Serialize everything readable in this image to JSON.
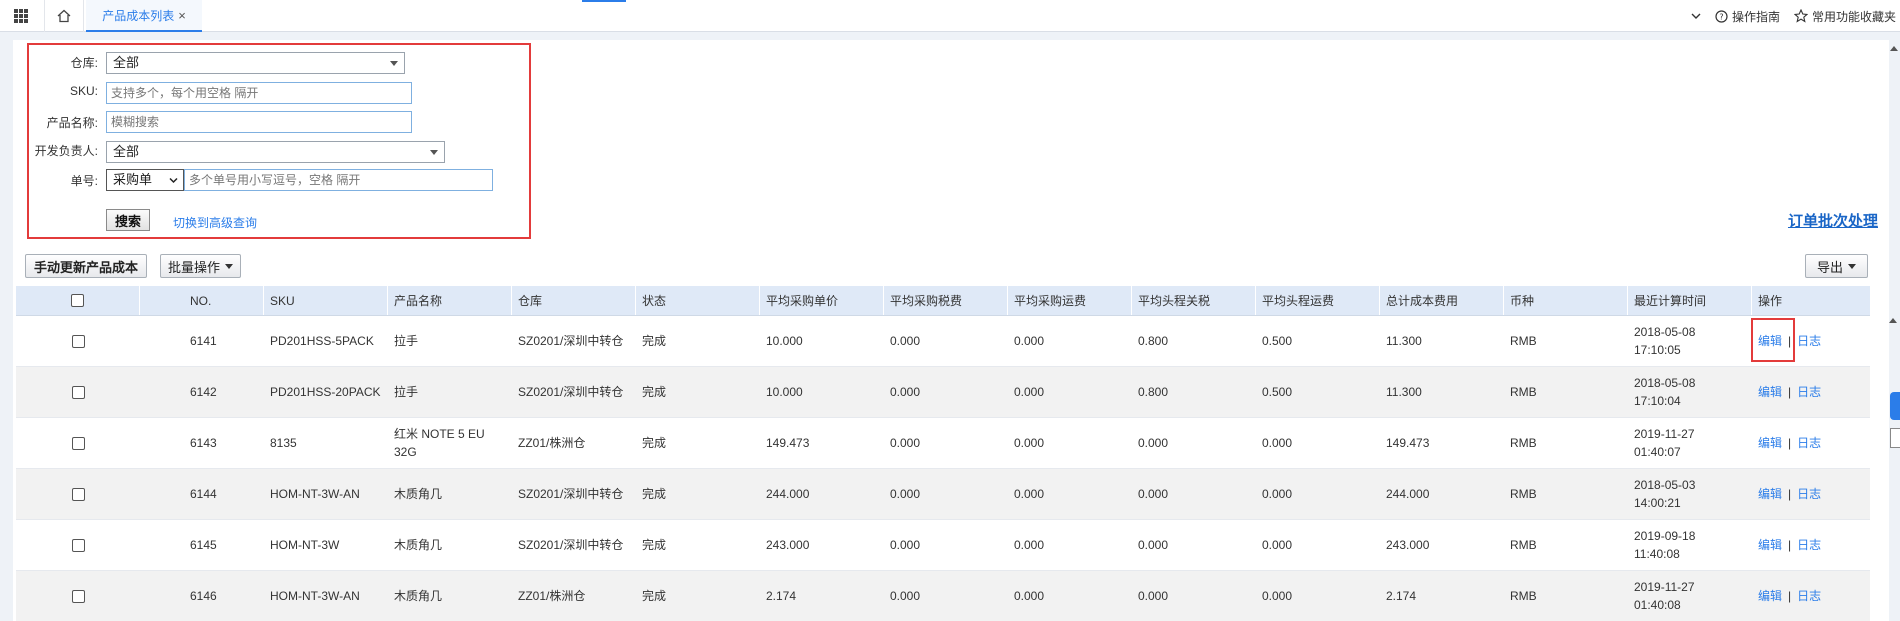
{
  "topbar": {
    "tab_label": "产品成本列表",
    "close_glyph": "×",
    "guide_label": "操作指南",
    "favorites_label": "常用功能收藏夹",
    "accent_color": "#2b7de9"
  },
  "search": {
    "warehouse_label": "仓库:",
    "warehouse_value": "全部",
    "sku_label": "SKU:",
    "sku_placeholder": "支持多个，每个用空格 隔开",
    "name_label": "产品名称:",
    "name_placeholder": "模糊搜索",
    "dev_label": "开发负责人:",
    "dev_value": "全部",
    "order_label": "单号:",
    "order_type_value": "采购单",
    "order_placeholder": "多个单号用小写逗号，空格 隔开",
    "search_button": "搜索",
    "advanced_link": "切换到高级查询"
  },
  "batch_process_link": "订单批次处理",
  "toolbar": {
    "update_cost_button": "手动更新产品成本",
    "batch_ops_button": "批量操作",
    "export_button": "导出"
  },
  "table": {
    "headers": [
      "",
      "NO.",
      "SKU",
      "产品名称",
      "仓库",
      "状态",
      "平均采购单价",
      "平均采购税费",
      "平均采购运费",
      "平均头程关税",
      "平均头程运费",
      "总计成本费用",
      "币种",
      "最近计算时间",
      "操作"
    ],
    "rows": [
      {
        "no": "6141",
        "sku": "PD201HSS-5PACK",
        "name": "拉手",
        "warehouse": "SZ0201/深圳中转仓",
        "status": "完成",
        "unit_price": "10.000",
        "tax": "0.000",
        "freight": "0.000",
        "duty": "0.800",
        "head_freight": "0.500",
        "total": "11.300",
        "currency": "RMB",
        "date": "2018-05-08",
        "time": "17:10:05",
        "edit": "编辑",
        "log": "日志"
      },
      {
        "no": "6142",
        "sku": "PD201HSS-20PACK",
        "name": "拉手",
        "warehouse": "SZ0201/深圳中转仓",
        "status": "完成",
        "unit_price": "10.000",
        "tax": "0.000",
        "freight": "0.000",
        "duty": "0.800",
        "head_freight": "0.500",
        "total": "11.300",
        "currency": "RMB",
        "date": "2018-05-08",
        "time": "17:10:04",
        "edit": "编辑",
        "log": "日志"
      },
      {
        "no": "6143",
        "sku": "8135",
        "name": "红米 NOTE 5 EU 32G",
        "warehouse": "ZZ01/株洲仓",
        "status": "完成",
        "unit_price": "149.473",
        "tax": "0.000",
        "freight": "0.000",
        "duty": "0.000",
        "head_freight": "0.000",
        "total": "149.473",
        "currency": "RMB",
        "date": "2019-11-27",
        "time": "01:40:07",
        "edit": "编辑",
        "log": "日志"
      },
      {
        "no": "6144",
        "sku": "HOM-NT-3W-AN",
        "name": "木质角几",
        "warehouse": "SZ0201/深圳中转仓",
        "status": "完成",
        "unit_price": "244.000",
        "tax": "0.000",
        "freight": "0.000",
        "duty": "0.000",
        "head_freight": "0.000",
        "total": "244.000",
        "currency": "RMB",
        "date": "2018-05-03",
        "time": "14:00:21",
        "edit": "编辑",
        "log": "日志"
      },
      {
        "no": "6145",
        "sku": "HOM-NT-3W",
        "name": "木质角几",
        "warehouse": "SZ0201/深圳中转仓",
        "status": "完成",
        "unit_price": "243.000",
        "tax": "0.000",
        "freight": "0.000",
        "duty": "0.000",
        "head_freight": "0.000",
        "total": "243.000",
        "currency": "RMB",
        "date": "2019-09-18",
        "time": "11:40:08",
        "edit": "编辑",
        "log": "日志"
      },
      {
        "no": "6146",
        "sku": "HOM-NT-3W-AN",
        "name": "木质角几",
        "warehouse": "ZZ01/株洲仓",
        "status": "完成",
        "unit_price": "2.174",
        "tax": "0.000",
        "freight": "0.000",
        "duty": "0.000",
        "head_freight": "0.000",
        "total": "2.174",
        "currency": "RMB",
        "date": "2019-11-27",
        "time": "01:40:08",
        "edit": "编辑",
        "log": "日志"
      }
    ]
  }
}
